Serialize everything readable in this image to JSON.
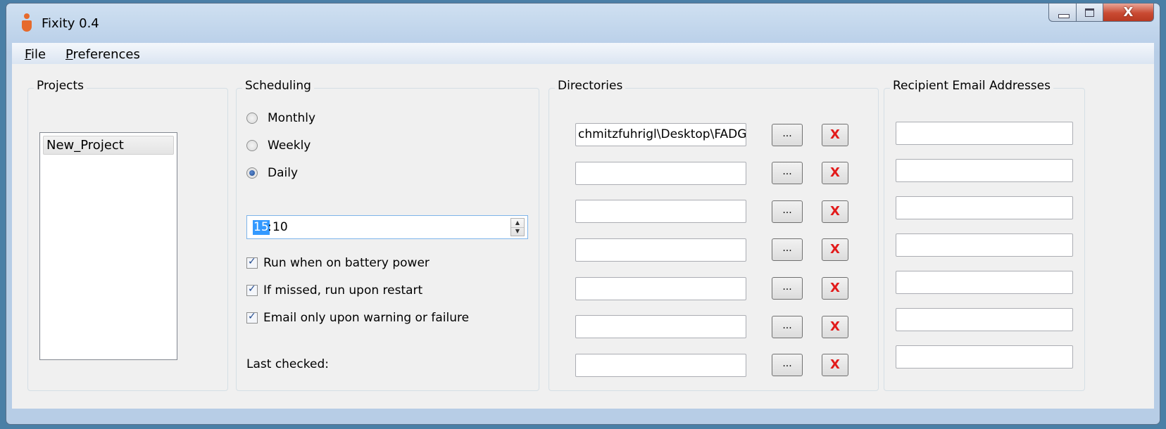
{
  "window": {
    "title": "Fixity 0.4",
    "close_glyph": "X"
  },
  "menu": {
    "file": {
      "accel": "F",
      "rest": "ile"
    },
    "preferences": {
      "accel": "P",
      "rest": "references"
    }
  },
  "projects": {
    "group_title": "Projects",
    "items": [
      "New_Project"
    ]
  },
  "scheduling": {
    "group_title": "Scheduling",
    "options": [
      "Monthly",
      "Weekly",
      "Daily"
    ],
    "selected": "Daily",
    "time_hour": "15",
    "time_sep": ":",
    "time_minute": "10",
    "checks": [
      {
        "label": "Run when on battery power",
        "checked": true
      },
      {
        "label": "If missed, run upon restart",
        "checked": true
      },
      {
        "label": "Email only upon warning or failure",
        "checked": true
      }
    ],
    "last_checked_label": "Last checked:"
  },
  "directories": {
    "group_title": "Directories",
    "browse_label": "...",
    "remove_label": "X",
    "entries": [
      "chmitzfuhrigl\\Desktop\\FADGI",
      "",
      "",
      "",
      "",
      "",
      ""
    ]
  },
  "emails": {
    "group_title": "Recipient Email Addresses",
    "entries": [
      "",
      "",
      "",
      "",
      "",
      "",
      ""
    ]
  },
  "icons": {
    "app": "fixity-app-icon",
    "minimize": "minimize-icon",
    "maximize": "maximize-icon",
    "close": "close-icon",
    "spin_up": "spin-up-icon",
    "spin_down": "spin-down-icon"
  }
}
